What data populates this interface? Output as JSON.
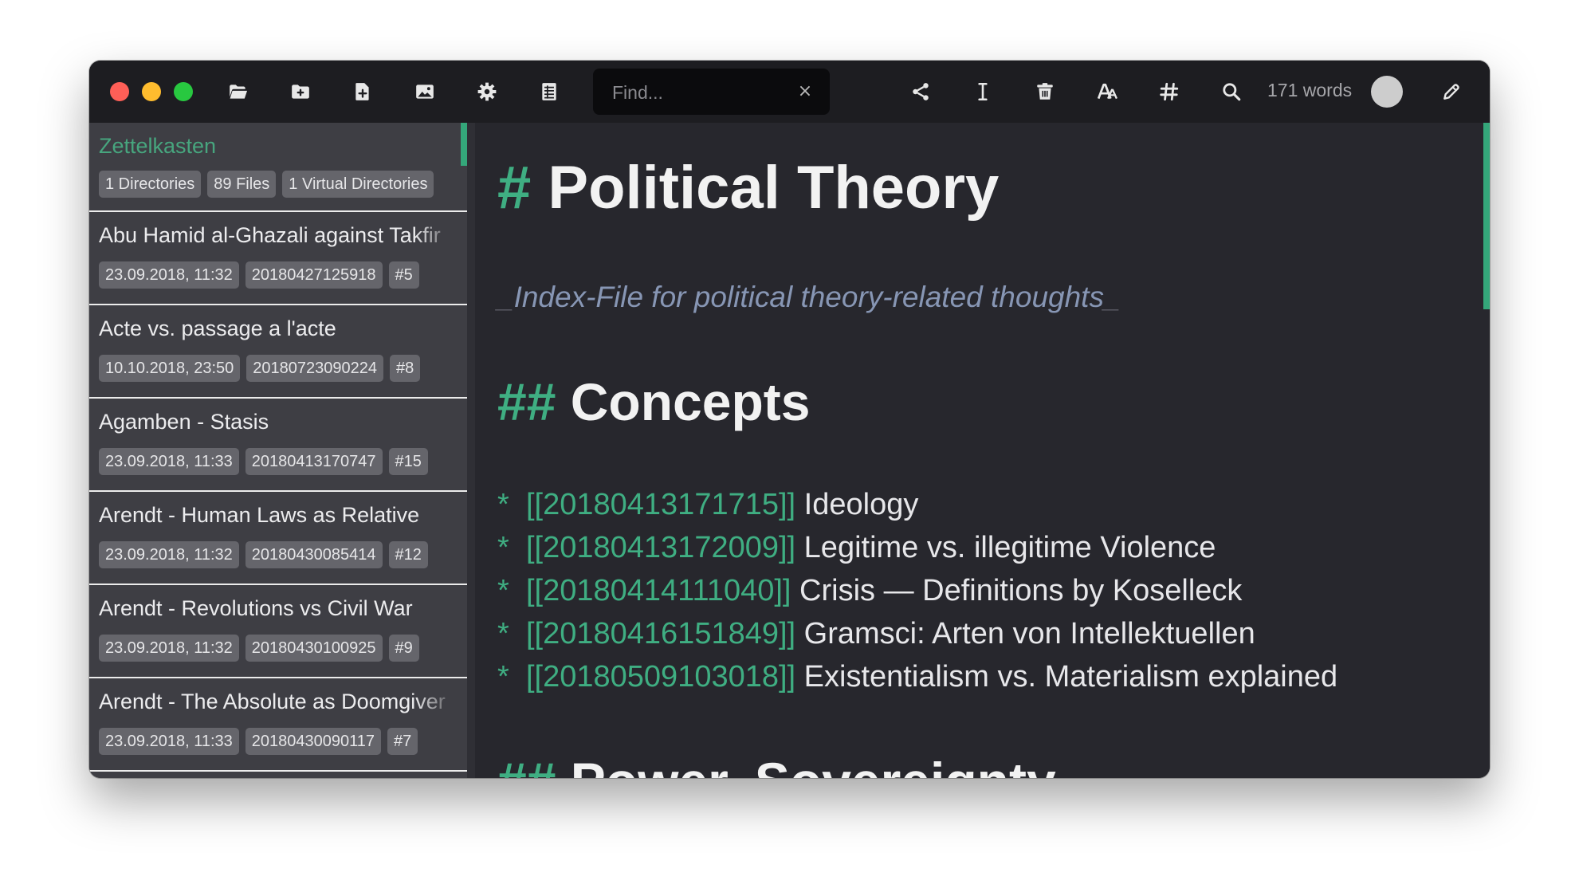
{
  "toolbar": {
    "find_placeholder": "Find...",
    "clear_glyph": "×",
    "word_count": "171 words",
    "left_icons": [
      "folder-open-icon",
      "folder-plus-icon",
      "file-plus-icon",
      "image-icon",
      "gear-icon",
      "table-icon"
    ],
    "right_icons": [
      "share-icon",
      "text-cursor-icon",
      "trash-icon",
      "font-size-icon",
      "hashtag-icon",
      "search-icon",
      "pencil-icon"
    ]
  },
  "sidebar": {
    "title": "Zettelkasten",
    "stats": [
      "1 Directories",
      "89 Files",
      "1 Virtual Directories"
    ],
    "files": [
      {
        "title": "Abu Hamid al-Ghazali against Takfir",
        "date": "23.09.2018, 11:32",
        "id": "20180427125918",
        "tag": "#5"
      },
      {
        "title": "Acte vs. passage a l'acte",
        "date": "10.10.2018, 23:50",
        "id": "20180723090224",
        "tag": "#8"
      },
      {
        "title": "Agamben - Stasis",
        "date": "23.09.2018, 11:33",
        "id": "20180413170747",
        "tag": "#15"
      },
      {
        "title": "Arendt - Human Laws as Relative",
        "date": "23.09.2018, 11:32",
        "id": "20180430085414",
        "tag": "#12"
      },
      {
        "title": "Arendt - Revolutions vs Civil War",
        "date": "23.09.2018, 11:32",
        "id": "20180430100925",
        "tag": "#9"
      },
      {
        "title": "Arendt - The Absolute as Doomgiver",
        "date": "23.09.2018, 11:33",
        "id": "20180430090117",
        "tag": "#7"
      }
    ]
  },
  "editor": {
    "h1_marker": "#",
    "h1_text": "Political Theory",
    "emphasis_open": "_",
    "emphasis_text": "Index-File for political theory-related thoughts",
    "emphasis_close": "_",
    "h2_marker": "##",
    "h2_concepts": "Concepts",
    "list_bullet": "*",
    "list": [
      {
        "link": "[[20180413171715]]",
        "text": "Ideology"
      },
      {
        "link": "[[20180413172009]]",
        "text": "Legitime vs. illegitime Violence"
      },
      {
        "link": "[[20180414111040]]",
        "text": "Crisis — Definitions by Koselleck"
      },
      {
        "link": "[[20180416151849]]",
        "text": "Gramsci: Arten von Intellektuellen"
      },
      {
        "link": "[[20180509103018]]",
        "text": "Existentialism vs. Materialism explained"
      }
    ],
    "h2_power": "Power, Sovereignty"
  },
  "colors": {
    "accent": "#3fae82",
    "close": "#fe5f57",
    "minimize": "#febc2e",
    "maximize": "#28c840",
    "editor_bg": "#27272d",
    "sidebar_bg": "#3e3e44",
    "toolbar_bg": "#1d1d21"
  }
}
